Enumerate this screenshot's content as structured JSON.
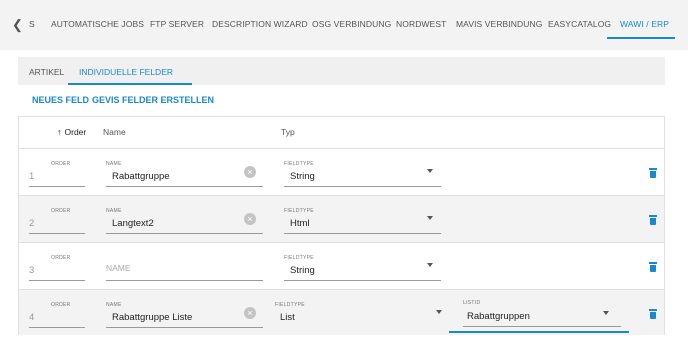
{
  "top_tabs": {
    "prev_icon": "chevron-left-icon",
    "items": [
      "S",
      "AUTOMATISCHE JOBS",
      "FTP SERVER",
      "DESCRIPTION WIZARD",
      "OSG VERBINDUNG",
      "NORDWEST",
      "MAVIS VERBINDUNG",
      "EASYCATALOG",
      "WAWI / ERP"
    ],
    "active": "WAWI / ERP"
  },
  "sub_tabs": {
    "items": [
      "ARTIKEL",
      "INDIVIDUELLE FELDER"
    ],
    "active": "INDIVIDUELLE FELDER"
  },
  "actions": {
    "new_field": "NEUES FELD",
    "create_gevis": "GEVIS FELDER ERSTELLEN"
  },
  "table": {
    "headers": {
      "order": "Order",
      "name": "Name",
      "type": "Typ"
    },
    "sort_icon": "arrow-up-icon",
    "labels": {
      "order": "ORDER",
      "name": "NAME",
      "fieldtype": "FIELDTYPE",
      "listid": "LISTID"
    },
    "rows": [
      {
        "order": "1",
        "name": "Rabattgruppe",
        "fieldtype": "String"
      },
      {
        "order": "2",
        "name": "Langtext2",
        "fieldtype": "Html"
      },
      {
        "order": "3",
        "name_placeholder": "NAME",
        "fieldtype": "String"
      },
      {
        "order": "4",
        "name": "Rabattgruppe Liste",
        "fieldtype": "List",
        "listid": "Rabattgruppen"
      }
    ]
  },
  "colors": {
    "accent": "#1a88cf",
    "tabbar_bg": "#f3f3f3",
    "row_alt_bg": "#f3f3f3"
  }
}
